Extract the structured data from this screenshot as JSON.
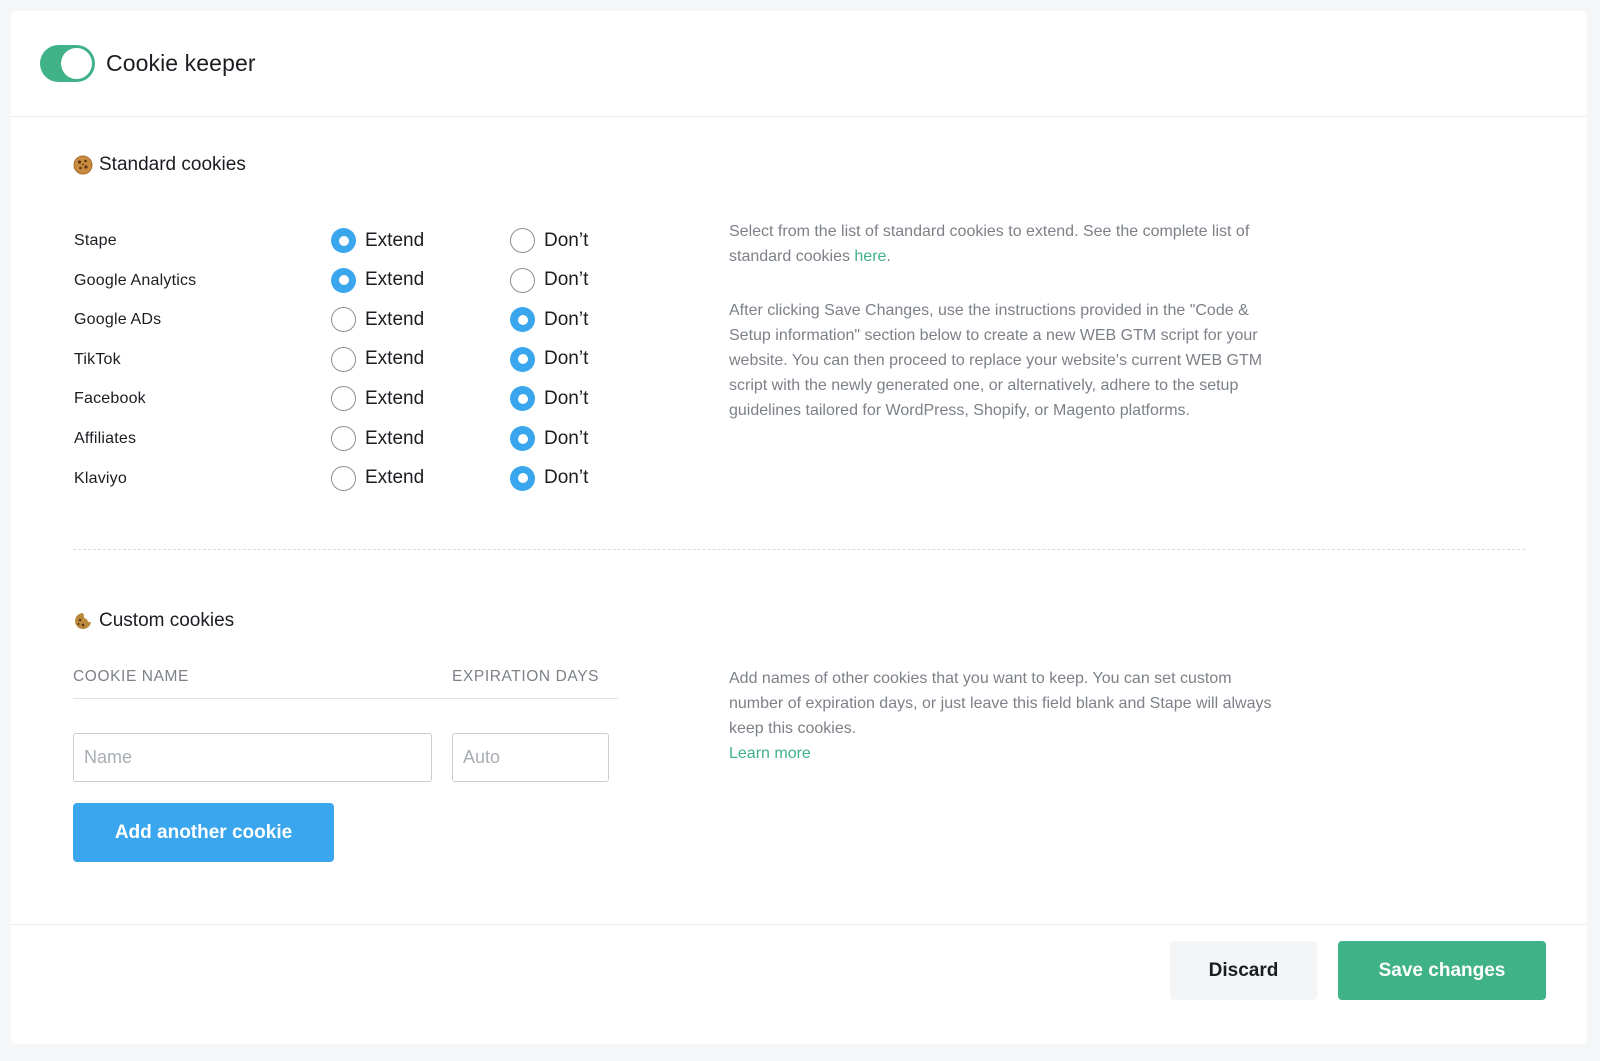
{
  "header": {
    "title": "Cookie keeper",
    "toggle_on": true
  },
  "standard": {
    "title": "Standard cookies",
    "icon": "cookie-icon",
    "extend_label": "Extend",
    "dont_label": "Don’t",
    "rows": [
      {
        "label": "Stape",
        "selected": "extend"
      },
      {
        "label": "Google Analytics",
        "selected": "extend"
      },
      {
        "label": "Google ADs",
        "selected": "dont"
      },
      {
        "label": "TikTok",
        "selected": "dont"
      },
      {
        "label": "Facebook",
        "selected": "dont"
      },
      {
        "label": "Affiliates",
        "selected": "dont"
      },
      {
        "label": "Klaviyo",
        "selected": "dont"
      }
    ],
    "help1_text": "Select from the list of standard cookies to extend. See the complete list of standard cookies ",
    "help1_link": "here",
    "help1_end": ".",
    "help2": "After clicking Save Changes, use the instructions provided in the \"Code & Setup information\" section below to create a new WEB GTM script for your website. You can then proceed to replace your website's current WEB GTM script with the newly generated one, or alternatively, adhere to the setup guidelines tailored for WordPress, Shopify, or Magento platforms."
  },
  "custom": {
    "title": "Custom cookies",
    "icon": "cookie-bite-icon",
    "col_name": "COOKIE NAME",
    "col_days": "EXPIRATION DAYS",
    "name_placeholder": "Name",
    "days_placeholder": "Auto",
    "add_button": "Add another cookie",
    "help": "Add names of other cookies that you want to keep. You can set custom number of expiration days, or just leave this field blank and Stape will always keep this cookies.",
    "learn_more": "Learn more"
  },
  "footer": {
    "discard": "Discard",
    "save": "Save changes"
  },
  "colors": {
    "accent_green": "#3fb287",
    "accent_blue": "#3aa6ee"
  }
}
